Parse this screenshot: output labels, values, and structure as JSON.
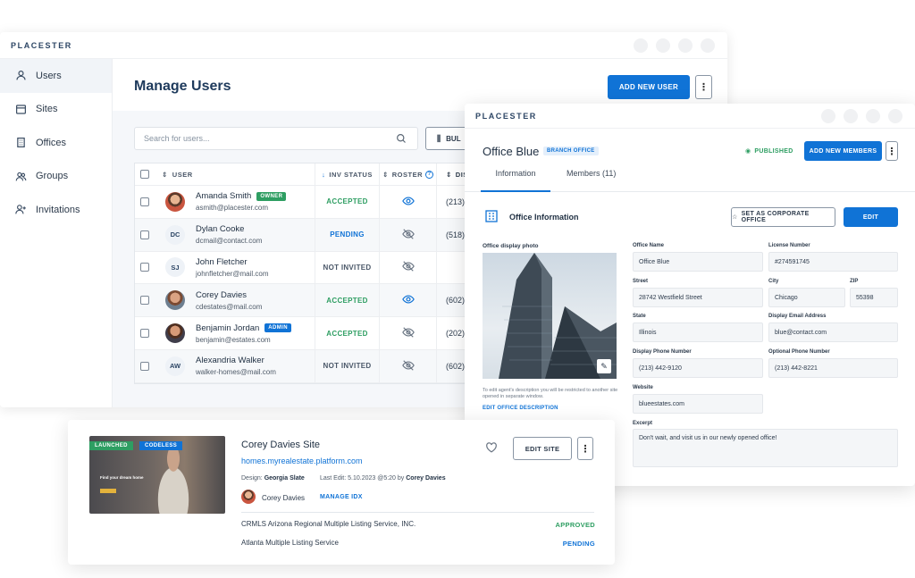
{
  "users_window": {
    "brand": "PLACESTER",
    "sidebar": [
      {
        "label": "Users",
        "icon": "user-icon"
      },
      {
        "label": "Sites",
        "icon": "browser-icon"
      },
      {
        "label": "Offices",
        "icon": "building-icon"
      },
      {
        "label": "Groups",
        "icon": "group-icon"
      },
      {
        "label": "Invitations",
        "icon": "user-plus-icon"
      }
    ],
    "title": "Manage Users",
    "add_user_label": "ADD NEW USER",
    "kebab": "⋮",
    "search_placeholder": "Search for users...",
    "bulk_label": "BUL",
    "columns": {
      "user": "USER",
      "inv": "INV STATUS",
      "roster": "ROSTER",
      "dis": "DIS"
    },
    "rows": [
      {
        "name": "Amanda Smith",
        "email": "asmith@placester.com",
        "badge": "OWNER",
        "status": "ACCEPTED",
        "dis": "(213)"
      },
      {
        "name": "Dylan Cooke",
        "initials": "DC",
        "email": "dcmail@contact.com",
        "status": "PENDING",
        "dis": "(518)"
      },
      {
        "name": "John Fletcher",
        "initials": "SJ",
        "email": "johnfletcher@mail.com",
        "status": "NOT INVITED",
        "dis": ""
      },
      {
        "name": "Corey Davies",
        "email": "cdestates@mail.com",
        "status": "ACCEPTED",
        "dis": "(602)"
      },
      {
        "name": "Benjamin Jordan",
        "email": "benjamin@estates.com",
        "badge": "ADMIN",
        "status": "ACCEPTED",
        "dis": "(202)"
      },
      {
        "name": "Alexandria Walker",
        "initials": "AW",
        "email": "walker-homes@mail.com",
        "status": "NOT INVITED",
        "dis": "(602)"
      }
    ]
  },
  "office_window": {
    "brand": "PLACESTER",
    "title": "Office Blue",
    "badge": "BRANCH OFFICE",
    "published": "PUBLISHED",
    "add_members_label": "ADD NEW MEMBERS",
    "tabs": [
      "Information",
      "Members (11)"
    ],
    "section_title": "Office Information",
    "set_corporate_label": "SET AS CORPORATE OFFICE",
    "edit_label": "EDIT",
    "photo_label": "Office display photo",
    "photo_note": "To edit agent's description you will be restricted to another site opened in separate window.",
    "photo_link": "EDIT OFFICE DESCRIPTION",
    "fields": {
      "office_name": {
        "label": "Office Name",
        "value": "Office Blue"
      },
      "license": {
        "label": "License Number",
        "value": "#274591745"
      },
      "street": {
        "label": "Street",
        "value": "28742 Westfield Street"
      },
      "city": {
        "label": "City",
        "value": "Chicago"
      },
      "zip": {
        "label": "ZIP",
        "value": "55398"
      },
      "state": {
        "label": "State",
        "value": "Illinois"
      },
      "email": {
        "label": "Display Email Address",
        "value": "blue@contact.com"
      },
      "phone": {
        "label": "Display Phone Number",
        "value": "(213) 442-9120"
      },
      "opt_phone": {
        "label": "Optional Phone Number",
        "value": "(213) 442-8221"
      },
      "website": {
        "label": "Website",
        "value": "blueestates.com"
      },
      "excerpt": {
        "label": "Excerpt",
        "value": "Don't wait, and visit us in our newly opened office!"
      }
    }
  },
  "site_card": {
    "launched": "LAUNCHED",
    "codeless": "CODELESS",
    "thumb_text": "Find your dream home",
    "title": "Corey Davies Site",
    "url": "homes.myrealestate.platform.com",
    "design_prefix": "Design:",
    "design_value": "Georgia Slate",
    "edit_prefix": "Last Edit: 5.10.2023 @5:20 by",
    "edit_value": "Corey Davies",
    "owner": "Corey Davies",
    "manage_idx": "MANAGE IDX",
    "edit_site_label": "EDIT SITE",
    "mls": [
      {
        "name": "CRMLS Arizona Regional Multiple Listing Service, INC.",
        "status": "APPROVED"
      },
      {
        "name": "Atlanta Multiple Listing Service",
        "status": "PENDING"
      }
    ]
  },
  "colors": {
    "primary": "#1073d6",
    "success": "#2e9e62",
    "title": "#1e3a5c"
  }
}
